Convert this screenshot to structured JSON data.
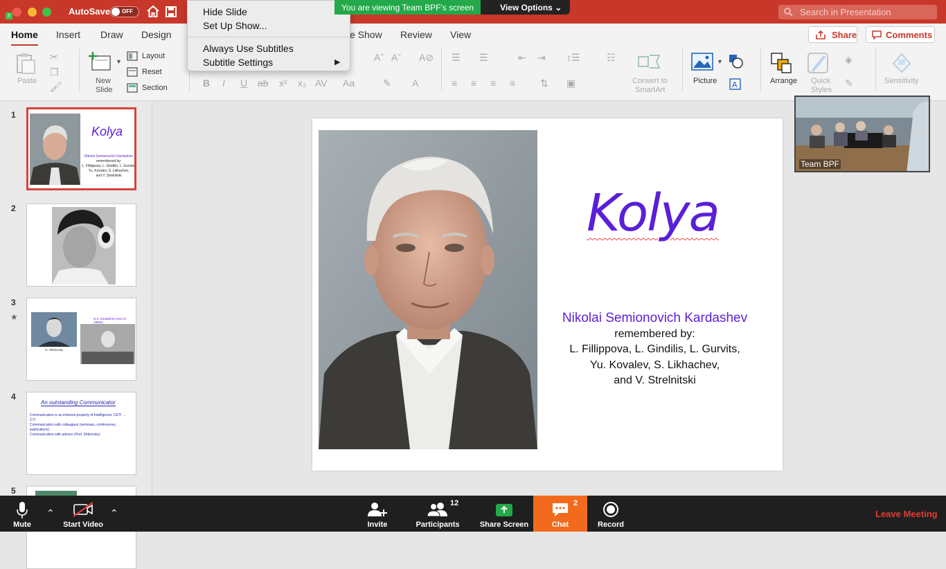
{
  "titlebar": {
    "autosave_label": "AutoSave",
    "toggle_state": "OFF",
    "search_placeholder": "Search in Presentation"
  },
  "share_banner": {
    "message": "You are viewing Team BPF's screen",
    "view_options": "View Options"
  },
  "menu": {
    "items": [
      "Hide Slide",
      "Set Up Show...",
      "Always Use Subtitles",
      "Subtitle Settings"
    ]
  },
  "tabs": [
    "Home",
    "Insert",
    "Draw",
    "Design",
    "e Show",
    "Review",
    "View"
  ],
  "actions": {
    "share": "Share",
    "comments": "Comments"
  },
  "ribbon": {
    "paste": "Paste",
    "new_slide_1": "New",
    "new_slide_2": "Slide",
    "layout": "Layout",
    "reset": "Reset",
    "section": "Section",
    "convert_1": "Convert to",
    "convert_2": "SmartArt",
    "picture": "Picture",
    "arrange": "Arrange",
    "quick_1": "Quick",
    "quick_2": "Styles",
    "sensitivity": "Sensitivity"
  },
  "slide_panel": {
    "numbers": [
      "1",
      "2",
      "3",
      "4",
      "5"
    ]
  },
  "thumbs": {
    "t1_title": "Kolya",
    "t1_name": "Nikolai Semionovich Kardashev",
    "t1_lines": [
      "remembered by:",
      "L. Fillippova, L. Gindilis, L. Gurvits,",
      "Yu. Kovalev, S. Likhachev,",
      "and V. Strelnitski"
    ],
    "t3_caption_top": "N.S. Kardashev (end of 1950s)",
    "t3_caption_left": "G. Shklovsky",
    "t4_title_1": "An outstanding ",
    "t4_title_2": "Communicator",
    "t4_bullets": [
      "Communication is an inherent property of Intelligence; CETI → CTI",
      "Communication with colleagues (seminars, conferences, publications)",
      "Communication with advisor (Prof. Shklovsky)"
    ]
  },
  "slide": {
    "title": "Kolya",
    "name": "Nikolai Semionovich Kardashev",
    "credits": [
      "remembered by:",
      "L. Fillippova, L. Gindilis, L. Gurvits,",
      "Yu. Kovalev, S. Likhachev,",
      "and V. Strelnitski"
    ]
  },
  "video": {
    "label": "Team BPF"
  },
  "zoombar": {
    "mute": "Mute",
    "start_video": "Start Video",
    "invite": "Invite",
    "participants": "Participants",
    "participants_count": "12",
    "share_screen": "Share Screen",
    "chat": "Chat",
    "chat_count": "2",
    "record": "Record",
    "leave": "Leave Meeting"
  },
  "colors": {
    "accent": "#c8382a",
    "title_purple": "#5a1fd8",
    "share_green": "#23a94a",
    "chat_orange": "#f26b1d",
    "leave_red": "#e23b36"
  }
}
